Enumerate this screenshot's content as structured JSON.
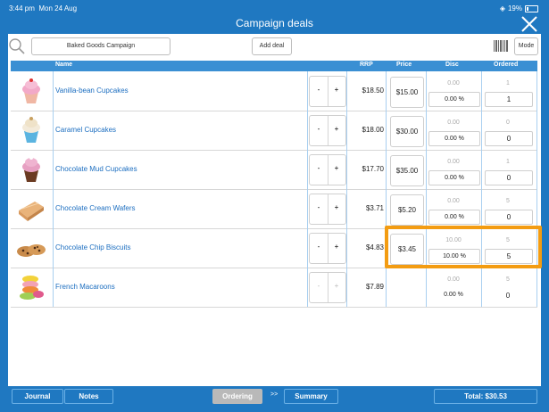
{
  "status_bar": {
    "time": "3:44 pm",
    "date": "Mon 24 Aug",
    "wifi": "◈",
    "battery": "19%"
  },
  "header": {
    "title": "Campaign deals"
  },
  "toolbar": {
    "campaign_value": "Baked Goods Campaign",
    "add_deal_label": "Add deal",
    "mode_label": "Mode"
  },
  "table_headers": {
    "name": "Name",
    "rrp": "RRP",
    "price": "Price",
    "disc": "Disc",
    "ordered": "Ordered"
  },
  "rows": [
    {
      "name": "Vanilla-bean Cupcakes",
      "minus": "-",
      "plus": "+",
      "rrp": "$18.50",
      "price": "$15.00",
      "disc_top": "0.00",
      "disc": "0.00 %",
      "ordered_top": "1",
      "ordered": "1"
    },
    {
      "name": "Caramel Cupcakes",
      "minus": "-",
      "plus": "+",
      "rrp": "$18.00",
      "price": "$30.00",
      "disc_top": "0.00",
      "disc": "0.00 %",
      "ordered_top": "0",
      "ordered": "0"
    },
    {
      "name": "Chocolate Mud Cupcakes",
      "minus": "-",
      "plus": "+",
      "rrp": "$17.70",
      "price": "$35.00",
      "disc_top": "0.00",
      "disc": "0.00 %",
      "ordered_top": "1",
      "ordered": "0"
    },
    {
      "name": "Chocolate Cream Wafers",
      "minus": "-",
      "plus": "+",
      "rrp": "$3.71",
      "price": "$5.20",
      "disc_top": "0.00",
      "disc": "0.00 %",
      "ordered_top": "5",
      "ordered": "0"
    },
    {
      "name": "Chocolate Chip Biscuits",
      "minus": "-",
      "plus": "+",
      "rrp": "$4.83",
      "price": "$3.45",
      "disc_top": "10.00",
      "disc": "10.00 %",
      "ordered_top": "5",
      "ordered": "5"
    },
    {
      "name": "French Macaroons",
      "minus": "-",
      "plus": "+",
      "rrp": "$7.89",
      "price": "",
      "disc_top": "0.00",
      "disc": "0.00 %",
      "ordered_top": "5",
      "ordered": "0"
    }
  ],
  "footer": {
    "journal": "Journal",
    "notes": "Notes",
    "ordering": "Ordering",
    "arrows": ">>",
    "summary": "Summary",
    "total": "Total: $30.53"
  },
  "colors": {
    "brand_blue": "#1f78c1",
    "header_blue": "#3a8fd3",
    "link_blue": "#1c6ec0",
    "highlight": "#f39c12"
  },
  "icons": {
    "search": "search-icon",
    "close": "close-icon",
    "barcode": "barcode-icon"
  }
}
